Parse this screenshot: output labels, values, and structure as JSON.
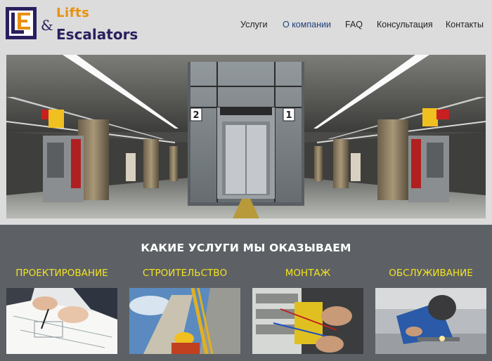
{
  "brand": {
    "line1": "Lifts",
    "amp": "&",
    "line2": "Escalators",
    "logo_letters": "LE",
    "colors": {
      "navy": "#2a1f5e",
      "orange": "#e8910f"
    }
  },
  "nav": {
    "items": [
      {
        "label": "Услуги",
        "active": false
      },
      {
        "label": "О компании",
        "active": true
      },
      {
        "label": "FAQ",
        "active": false
      },
      {
        "label": "Консультация",
        "active": false
      },
      {
        "label": "Контакты",
        "active": false
      }
    ]
  },
  "hero": {
    "level_left": "2",
    "level_right": "1",
    "alt": "Станция метро с лифтом"
  },
  "services": {
    "heading": "КАКИЕ УСЛУГИ МЫ ОКАЗЫВАЕМ",
    "items": [
      {
        "title": "ПРОЕКТИРОВАНИЕ"
      },
      {
        "title": "СТРОИТЕЛЬСТВО"
      },
      {
        "title": "МОНТАЖ"
      },
      {
        "title": "ОБСЛУЖИВАНИЕ"
      }
    ],
    "accent_color": "#f4e224"
  }
}
